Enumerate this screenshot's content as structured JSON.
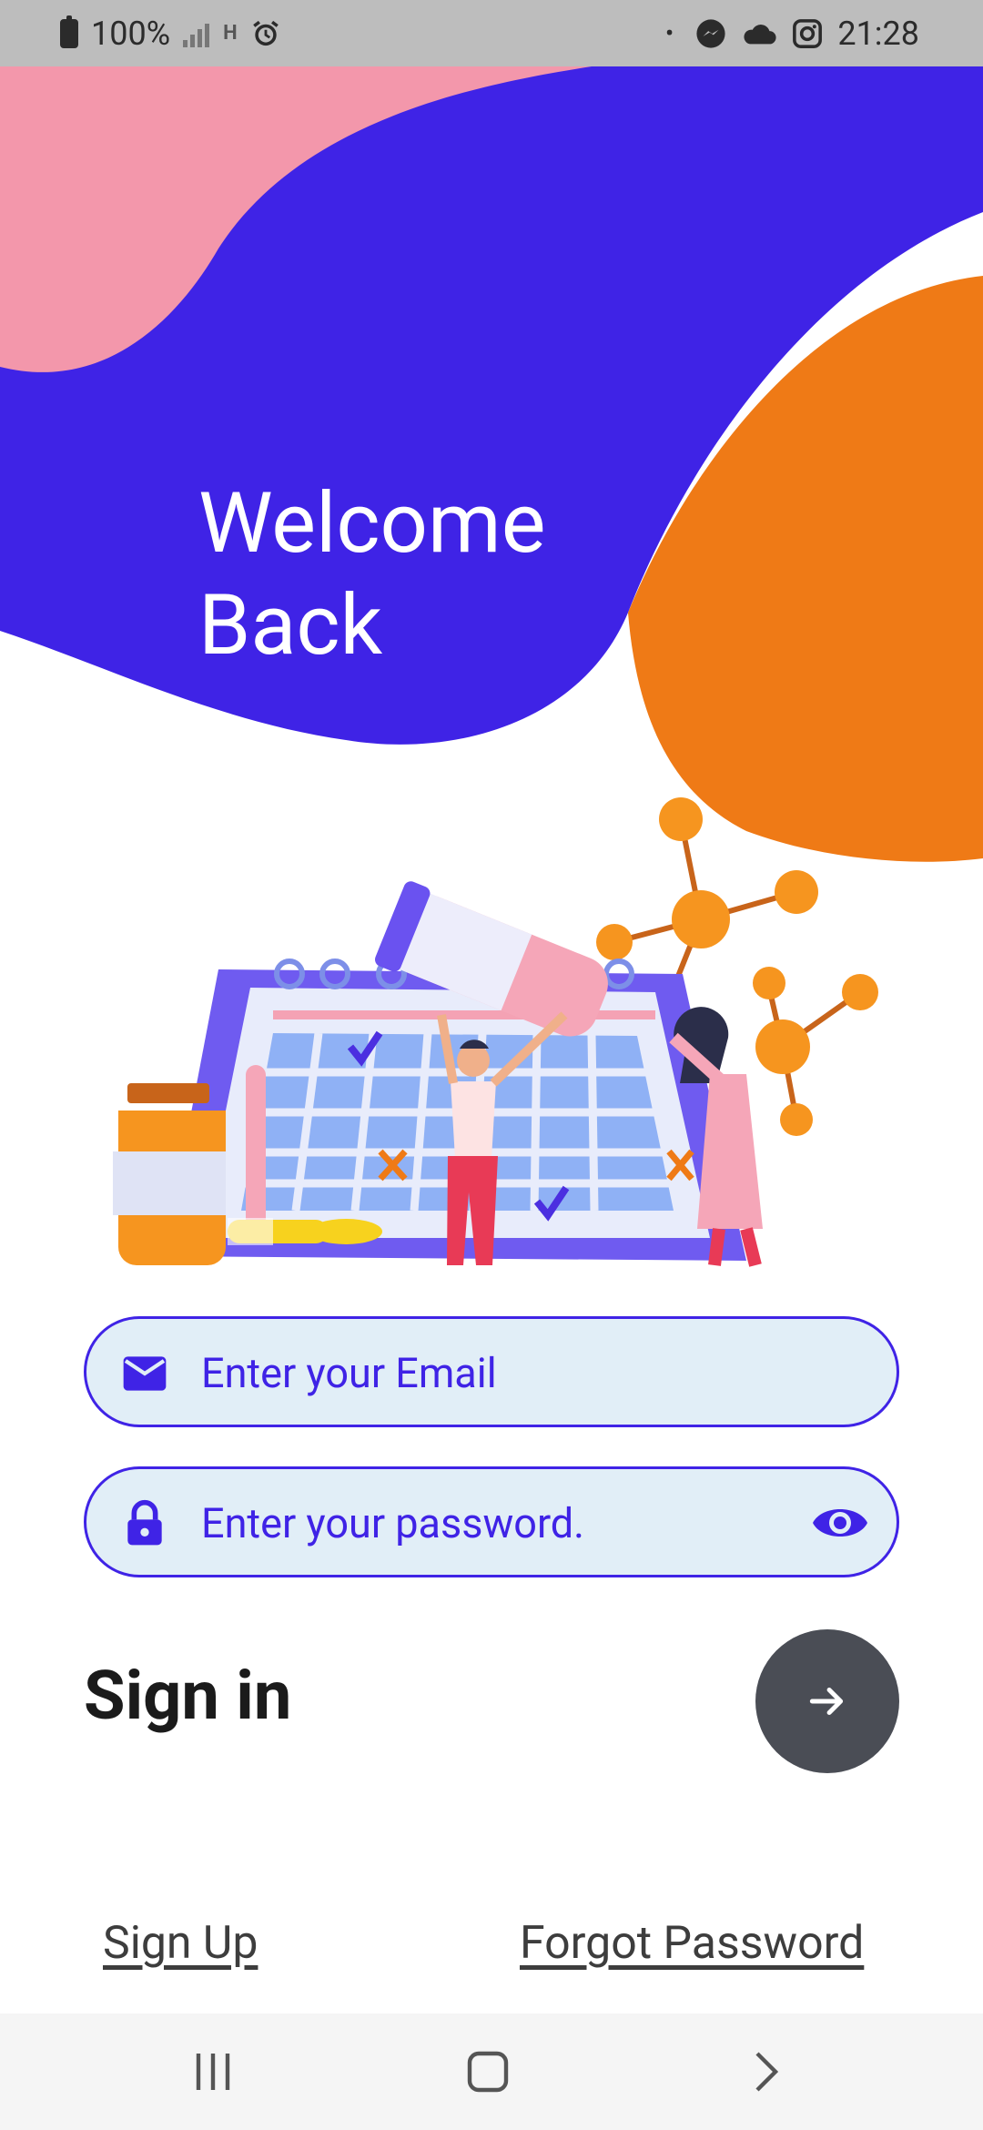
{
  "status_bar": {
    "battery": "100%",
    "network_type": "H",
    "dot": "•",
    "time": "21:28"
  },
  "header": {
    "title_line1": "Welcome",
    "title_line2": "Back",
    "colors": {
      "pink": "#f397ab",
      "purple": "#3f23e6",
      "orange": "#ef7a16"
    }
  },
  "form": {
    "email": {
      "placeholder": "Enter your Email",
      "value": "",
      "icon": "mail-icon"
    },
    "password": {
      "placeholder": "Enter your password.",
      "value": "",
      "icon": "lock-icon",
      "toggle_icon": "eye-icon"
    },
    "submit_label": "Sign in",
    "submit_icon": "arrow-right-icon"
  },
  "links": {
    "sign_up": "Sign Up",
    "forgot_password": "Forgot Password"
  },
  "nav_bar": {
    "recent": "recent-apps-icon",
    "home": "home-icon",
    "back": "back-icon"
  }
}
